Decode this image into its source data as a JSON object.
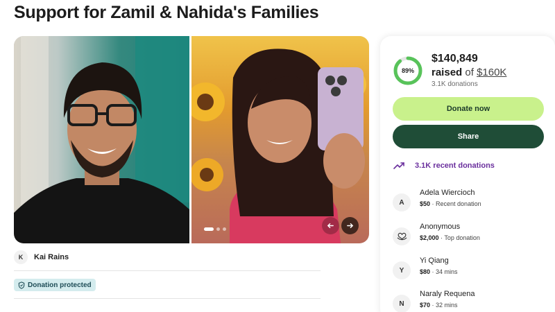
{
  "page": {
    "title": "Support for Zamil & Nahida's Families"
  },
  "gallery": {
    "slide_count": 3,
    "active_slide": 1,
    "prev_icon": "arrow-left-icon",
    "next_icon": "arrow-right-icon"
  },
  "organizer": {
    "initial": "K",
    "name": "Kai Rains"
  },
  "badge": {
    "label": "Donation protected",
    "icon": "shield-icon"
  },
  "fundraiser": {
    "progress_percent": 89,
    "progress_label": "89%",
    "raised": "$140,849",
    "raised_word": "raised",
    "of_word": "of",
    "goal": "$160K",
    "donations_count": "3.1K donations",
    "donate_label": "Donate now",
    "share_label": "Share",
    "recent_label": "3.1K recent donations",
    "recent_icon": "trending-up-icon"
  },
  "donors": [
    {
      "avatar": "A",
      "name": "Adela Wiercioch",
      "amount": "$50",
      "note": "Recent donation"
    },
    {
      "avatar": "",
      "avatar_icon": "heart-hands-icon",
      "name": "Anonymous",
      "amount": "$2,000",
      "note": "Top donation"
    },
    {
      "avatar": "Y",
      "name": "Yi Qiang",
      "amount": "$80",
      "note": "34 mins"
    },
    {
      "avatar": "N",
      "name": "Naraly Requena",
      "amount": "$70",
      "note": "32 mins"
    }
  ],
  "colors": {
    "donate_button": "#c9f18c",
    "share_button": "#1f4d37",
    "progress_ring": "#58c35a",
    "recent_accent": "#6a2f9d",
    "badge_bg": "#d4ecee"
  }
}
